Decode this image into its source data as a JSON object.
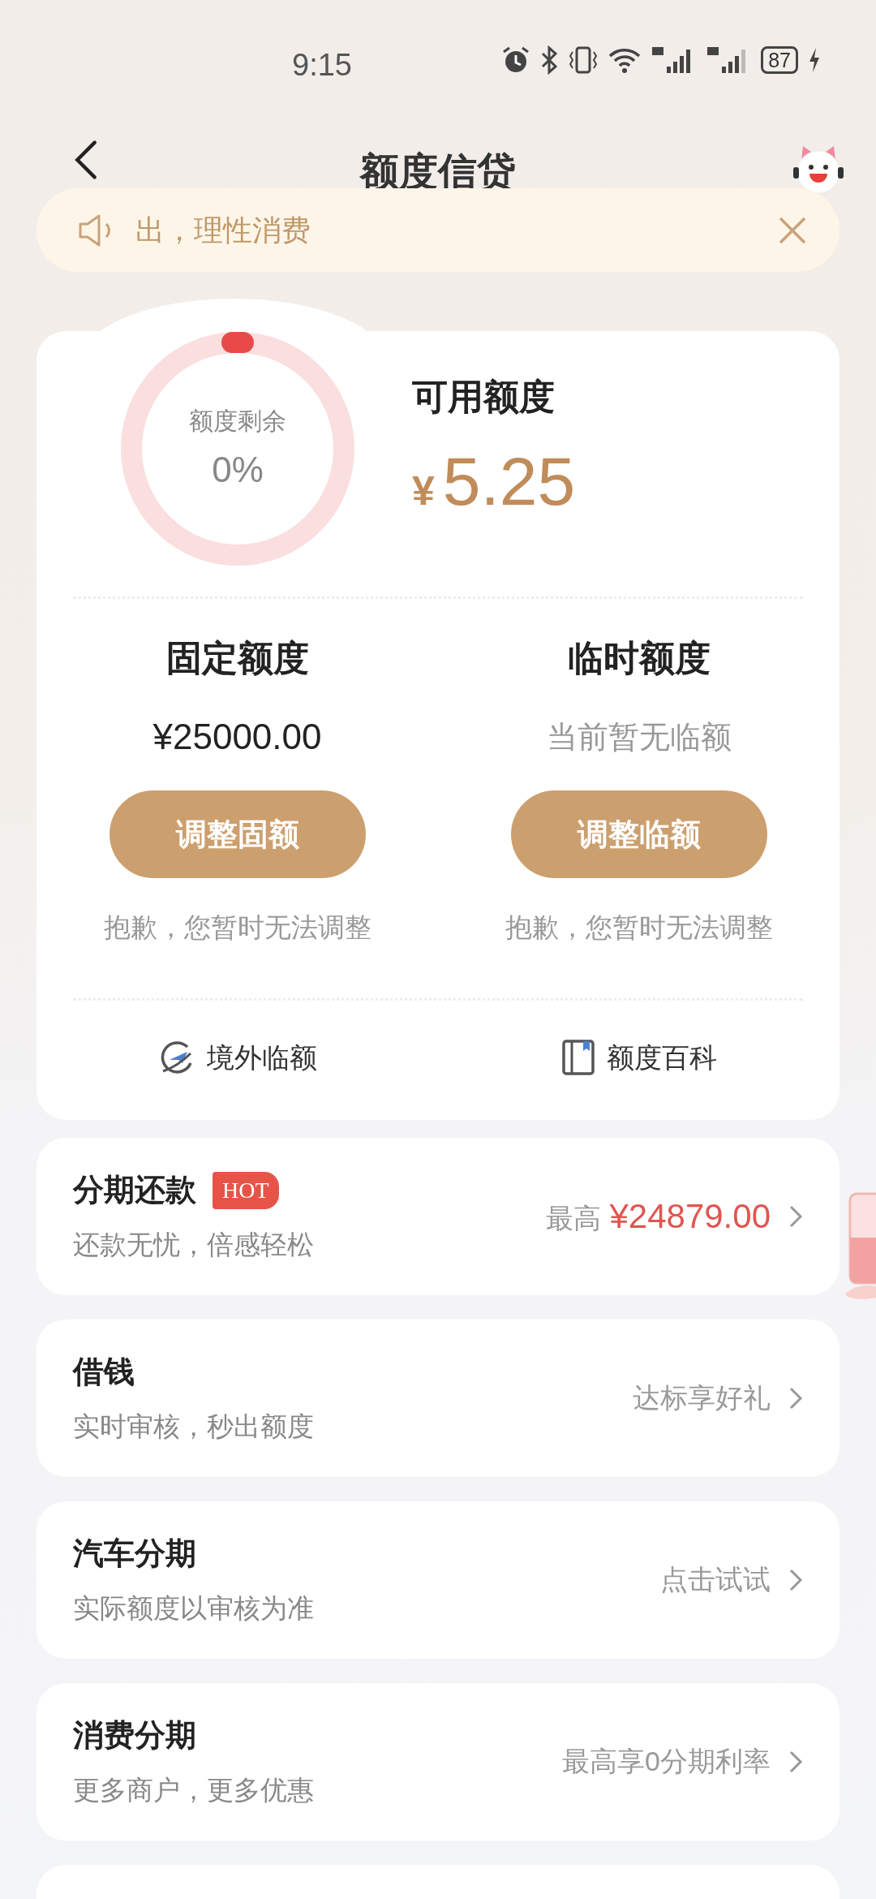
{
  "status_bar": {
    "time": "9:15",
    "battery": "87"
  },
  "header": {
    "title": "额度信贷"
  },
  "notice": {
    "text": "出，理性消费"
  },
  "quota": {
    "ring_label": "额度剩余",
    "ring_value": "0%",
    "available_label": "可用额度",
    "currency": "¥",
    "available_amount": "5.25",
    "columns": [
      {
        "title": "固定额度",
        "value": "¥25000.00",
        "kind": "amount",
        "button": "调整固额",
        "button_disabled_note": "抱歉，您暂时无法调整"
      },
      {
        "title": "临时额度",
        "value": "当前暂无临额",
        "kind": "note",
        "button": "调整临额",
        "button_disabled_note": "抱歉，您暂时无法调整"
      }
    ],
    "links": [
      {
        "kind": "plane",
        "label": "境外临额"
      },
      {
        "kind": "book",
        "label": "额度百科"
      }
    ]
  },
  "products": [
    {
      "title": "分期还款",
      "badge": "HOT",
      "subtitle": "还款无忧，倍感轻松",
      "hint_prefix": "最高",
      "hint": "¥24879.00",
      "kind": "amount"
    },
    {
      "title": "借钱",
      "subtitle": "实时审核，秒出额度",
      "hint": "达标享好礼",
      "kind": "plain"
    },
    {
      "title": "汽车分期",
      "subtitle": "实际额度以审核为准",
      "hint": "点击试试",
      "kind": "plain"
    },
    {
      "title": "消费分期",
      "subtitle": "更多商户，更多优惠",
      "hint": "最高享0分期利率",
      "kind": "plain"
    }
  ]
}
